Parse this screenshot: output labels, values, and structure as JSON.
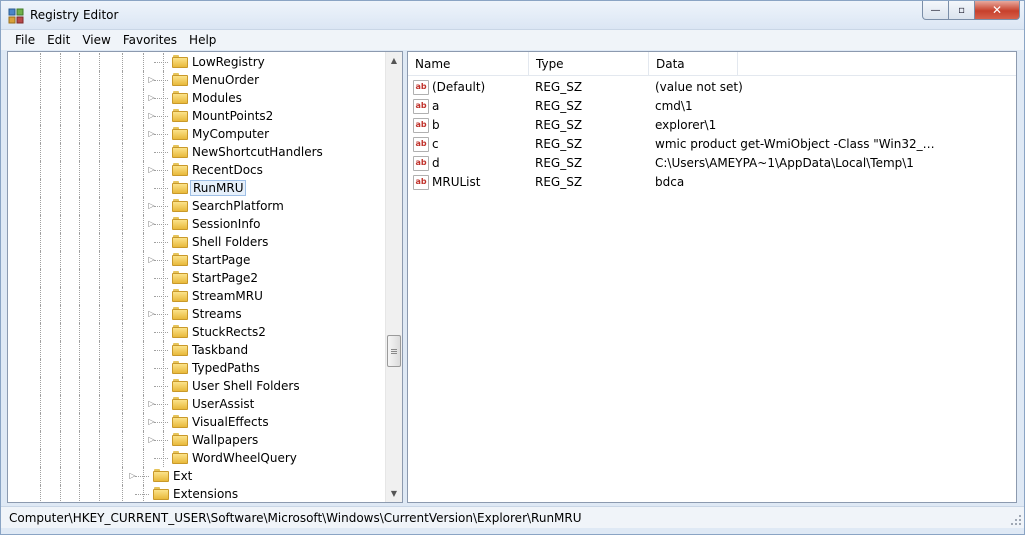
{
  "window": {
    "title": "Registry Editor",
    "caption_min": "—",
    "caption_max": "▫",
    "caption_close": "✕"
  },
  "menu": [
    "File",
    "Edit",
    "View",
    "Favorites",
    "Help"
  ],
  "tree": {
    "items": [
      {
        "label": "LowRegistry",
        "expandable": false
      },
      {
        "label": "MenuOrder",
        "expandable": true
      },
      {
        "label": "Modules",
        "expandable": true
      },
      {
        "label": "MountPoints2",
        "expandable": true
      },
      {
        "label": "MyComputer",
        "expandable": true
      },
      {
        "label": "NewShortcutHandlers",
        "expandable": false
      },
      {
        "label": "RecentDocs",
        "expandable": true
      },
      {
        "label": "RunMRU",
        "expandable": false,
        "selected": true
      },
      {
        "label": "SearchPlatform",
        "expandable": true
      },
      {
        "label": "SessionInfo",
        "expandable": true
      },
      {
        "label": "Shell Folders",
        "expandable": false
      },
      {
        "label": "StartPage",
        "expandable": true
      },
      {
        "label": "StartPage2",
        "expandable": false
      },
      {
        "label": "StreamMRU",
        "expandable": false
      },
      {
        "label": "Streams",
        "expandable": true
      },
      {
        "label": "StuckRects2",
        "expandable": false
      },
      {
        "label": "Taskband",
        "expandable": false
      },
      {
        "label": "TypedPaths",
        "expandable": false
      },
      {
        "label": "User Shell Folders",
        "expandable": false
      },
      {
        "label": "UserAssist",
        "expandable": true
      },
      {
        "label": "VisualEffects",
        "expandable": true
      },
      {
        "label": "Wallpapers",
        "expandable": true
      },
      {
        "label": "WordWheelQuery",
        "expandable": false
      }
    ],
    "parent_items": [
      {
        "label": "Ext",
        "expandable": true
      },
      {
        "label": "Extensions",
        "expandable": false
      }
    ]
  },
  "list": {
    "columns": [
      "Name",
      "Type",
      "Data"
    ],
    "rows": [
      {
        "name": "(Default)",
        "type": "REG_SZ",
        "data": "(value not set)"
      },
      {
        "name": "a",
        "type": "REG_SZ",
        "data": "cmd\\1"
      },
      {
        "name": "b",
        "type": "REG_SZ",
        "data": "explorer\\1"
      },
      {
        "name": "c",
        "type": "REG_SZ",
        "data": "wmic product get-WmiObject -Class \"Win32_Prod..."
      },
      {
        "name": "d",
        "type": "REG_SZ",
        "data": "C:\\Users\\AMEYPA~1\\AppData\\Local\\Temp\\1"
      },
      {
        "name": "MRUList",
        "type": "REG_SZ",
        "data": "bdca"
      }
    ]
  },
  "status": {
    "path": "Computer\\HKEY_CURRENT_USER\\Software\\Microsoft\\Windows\\CurrentVersion\\Explorer\\RunMRU"
  },
  "icons": {
    "app": "registry-editor-icon",
    "folder": "folder-icon",
    "value": "string-value-icon",
    "value_glyph": "ab"
  },
  "colors": {
    "selection_bg": "#e6f0fb",
    "selection_border": "#9ebfe6",
    "close_button": "#c7402b"
  }
}
